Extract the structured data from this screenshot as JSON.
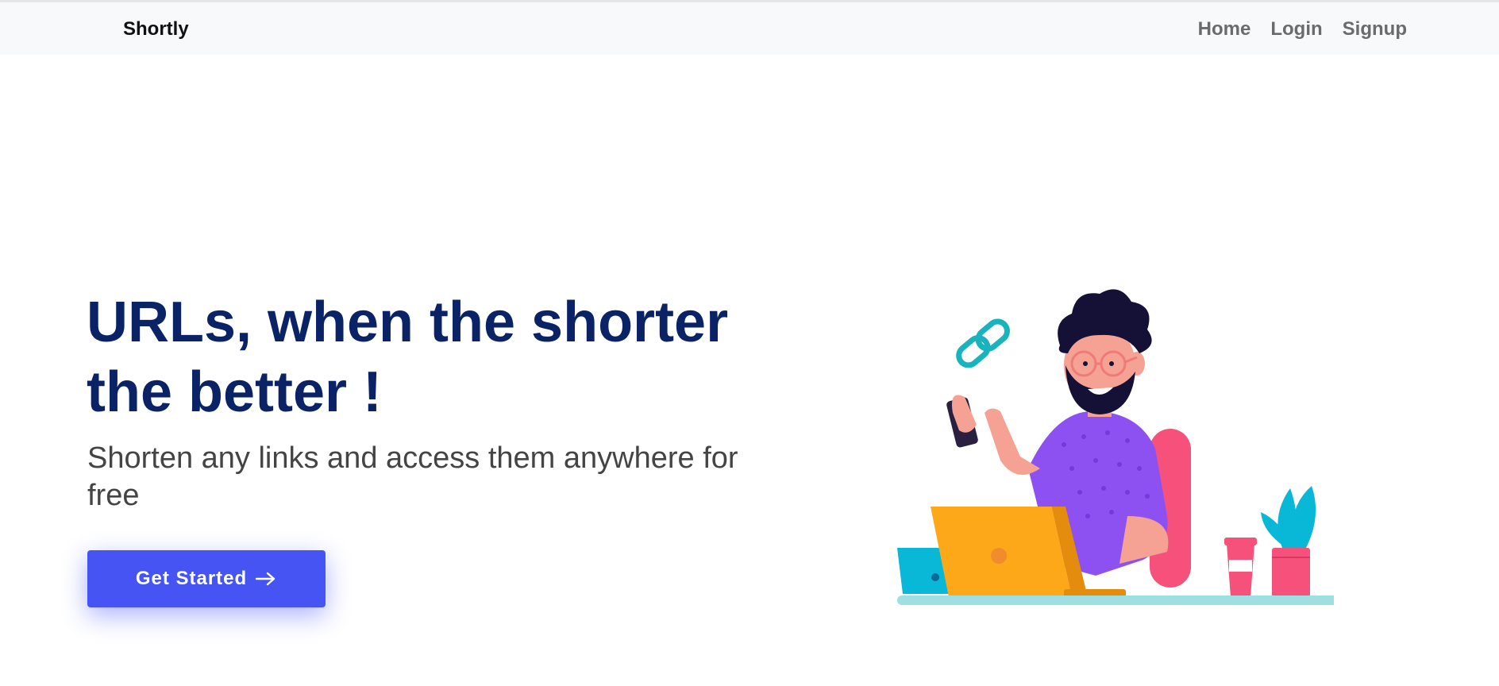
{
  "navbar": {
    "brand": "Shortly",
    "links": [
      {
        "label": "Home"
      },
      {
        "label": "Login"
      },
      {
        "label": "Signup"
      }
    ]
  },
  "hero": {
    "title": "URLs, when the shorter the better !",
    "subtitle": "Shorten any links and access them anywhere for free",
    "cta_label": "Get Started",
    "cta_icon": "arrow-right-icon"
  },
  "colors": {
    "title": "#0a2366",
    "cta_bg": "#4554f3",
    "navbar_bg": "#f8f9fa",
    "link": "#6b6b6b"
  },
  "illustration": {
    "icon": "link-chain-icon",
    "description_icons": [
      "man-with-laptop",
      "coffee-cup",
      "potted-plant"
    ]
  }
}
